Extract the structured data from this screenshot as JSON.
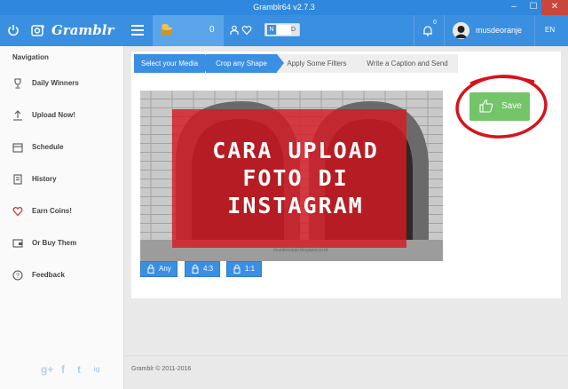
{
  "window": {
    "title": "Gramblr64 v2.7.3",
    "min": "–",
    "max": "☐",
    "close": "✕"
  },
  "topbar": {
    "brand": "Gramblr",
    "coins": "0",
    "nsfw_on_label": "N",
    "nsfw_off_label": "D",
    "notifications": "0",
    "username": "musdeoranje",
    "language": "EN"
  },
  "sidebar": {
    "title": "Navigation",
    "items": [
      {
        "label": "Daily Winners",
        "icon": "trophy-icon"
      },
      {
        "label": "Upload Now!",
        "icon": "upload-icon"
      },
      {
        "label": "Schedule",
        "icon": "calendar-icon"
      },
      {
        "label": "History",
        "icon": "history-icon"
      },
      {
        "label": "Earn Coins!",
        "icon": "heart-icon"
      },
      {
        "label": "Or Buy Them",
        "icon": "cart-icon"
      },
      {
        "label": "Feedback",
        "icon": "question-icon"
      }
    ],
    "social": [
      "g+",
      "f",
      "t",
      "ig"
    ]
  },
  "steps": [
    "Select your Media",
    "Crop any Shape",
    "Apply Some Filters",
    "Write a Caption and Send"
  ],
  "photo": {
    "caption_line1": "CARA UPLOAD",
    "caption_line2": "FOTO DI",
    "caption_line3": "INSTAGRAM",
    "watermark": "musdeoranje.blogspot.co.id"
  },
  "crop_buttons": [
    "Any",
    "4:3",
    "1:1"
  ],
  "save_label": "Save",
  "footer": "Gramblr © 2011-2016",
  "colors": {
    "primary": "#3a8fe0",
    "save": "#74c46a",
    "overlay": "#d61a22"
  }
}
